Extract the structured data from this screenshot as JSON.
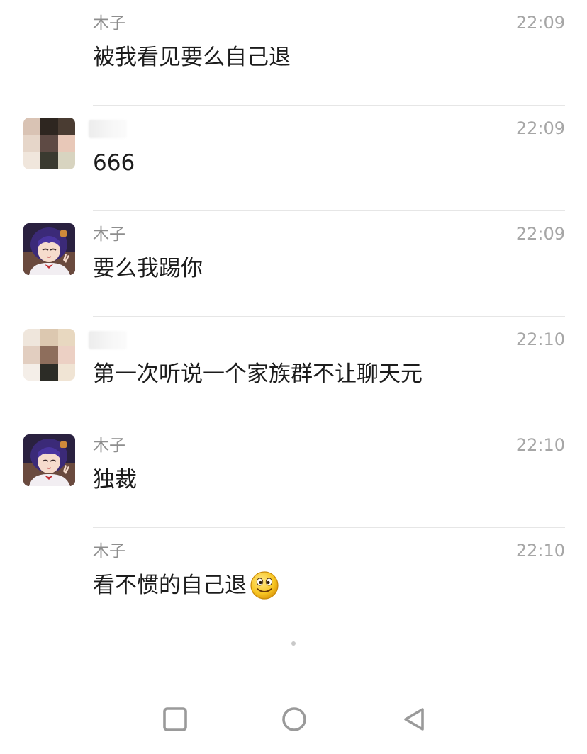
{
  "messages": [
    {
      "sender": "木子",
      "time": "22:09",
      "text": "被我看见要么自己退",
      "avatar": "none"
    },
    {
      "sender": "",
      "time": "22:09",
      "text": "666",
      "avatar": "blurred-photo-a"
    },
    {
      "sender": "木子",
      "time": "22:09",
      "text": "要么我踢你",
      "avatar": "anime-girl"
    },
    {
      "sender": "",
      "time": "22:10",
      "text": "第一次听说一个家族群不让聊天元",
      "avatar": "blurred-photo-b"
    },
    {
      "sender": "木子",
      "time": "22:10",
      "text": "独裁",
      "avatar": "anime-girl"
    },
    {
      "sender": "木子",
      "time": "22:10",
      "text": "看不惯的自己退",
      "avatar": "none",
      "emoji": "smiley-emoji"
    }
  ],
  "nav": {
    "buttons": [
      {
        "icon": "square-recents-icon"
      },
      {
        "icon": "circle-home-icon"
      },
      {
        "icon": "triangle-back-icon"
      }
    ]
  },
  "colors": {
    "text": "#1c1c1c",
    "meta": "#8e8e8e",
    "time": "#a6a6a6",
    "divider": "#e6e6e6"
  }
}
